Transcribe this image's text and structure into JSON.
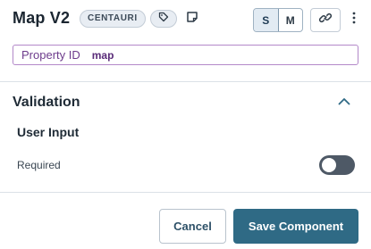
{
  "header": {
    "title": "Map V2",
    "badge": "CENTAURI",
    "icons": [
      "tag-icon",
      "note-icon",
      "link-icon",
      "more-vertical-icon"
    ],
    "size_toggle": {
      "options": [
        "S",
        "M"
      ],
      "selected": "S"
    }
  },
  "property": {
    "label": "Property ID",
    "value": "map"
  },
  "validation": {
    "title": "Validation",
    "group_label": "User Input",
    "required_label": "Required",
    "required_enabled": false
  },
  "footer": {
    "cancel_label": "Cancel",
    "save_label": "Save Component"
  },
  "colors": {
    "primary": "#2f6a85",
    "property_border": "#b388c9",
    "property_text": "#6d3c8c",
    "toggle_off": "#4e5966"
  }
}
